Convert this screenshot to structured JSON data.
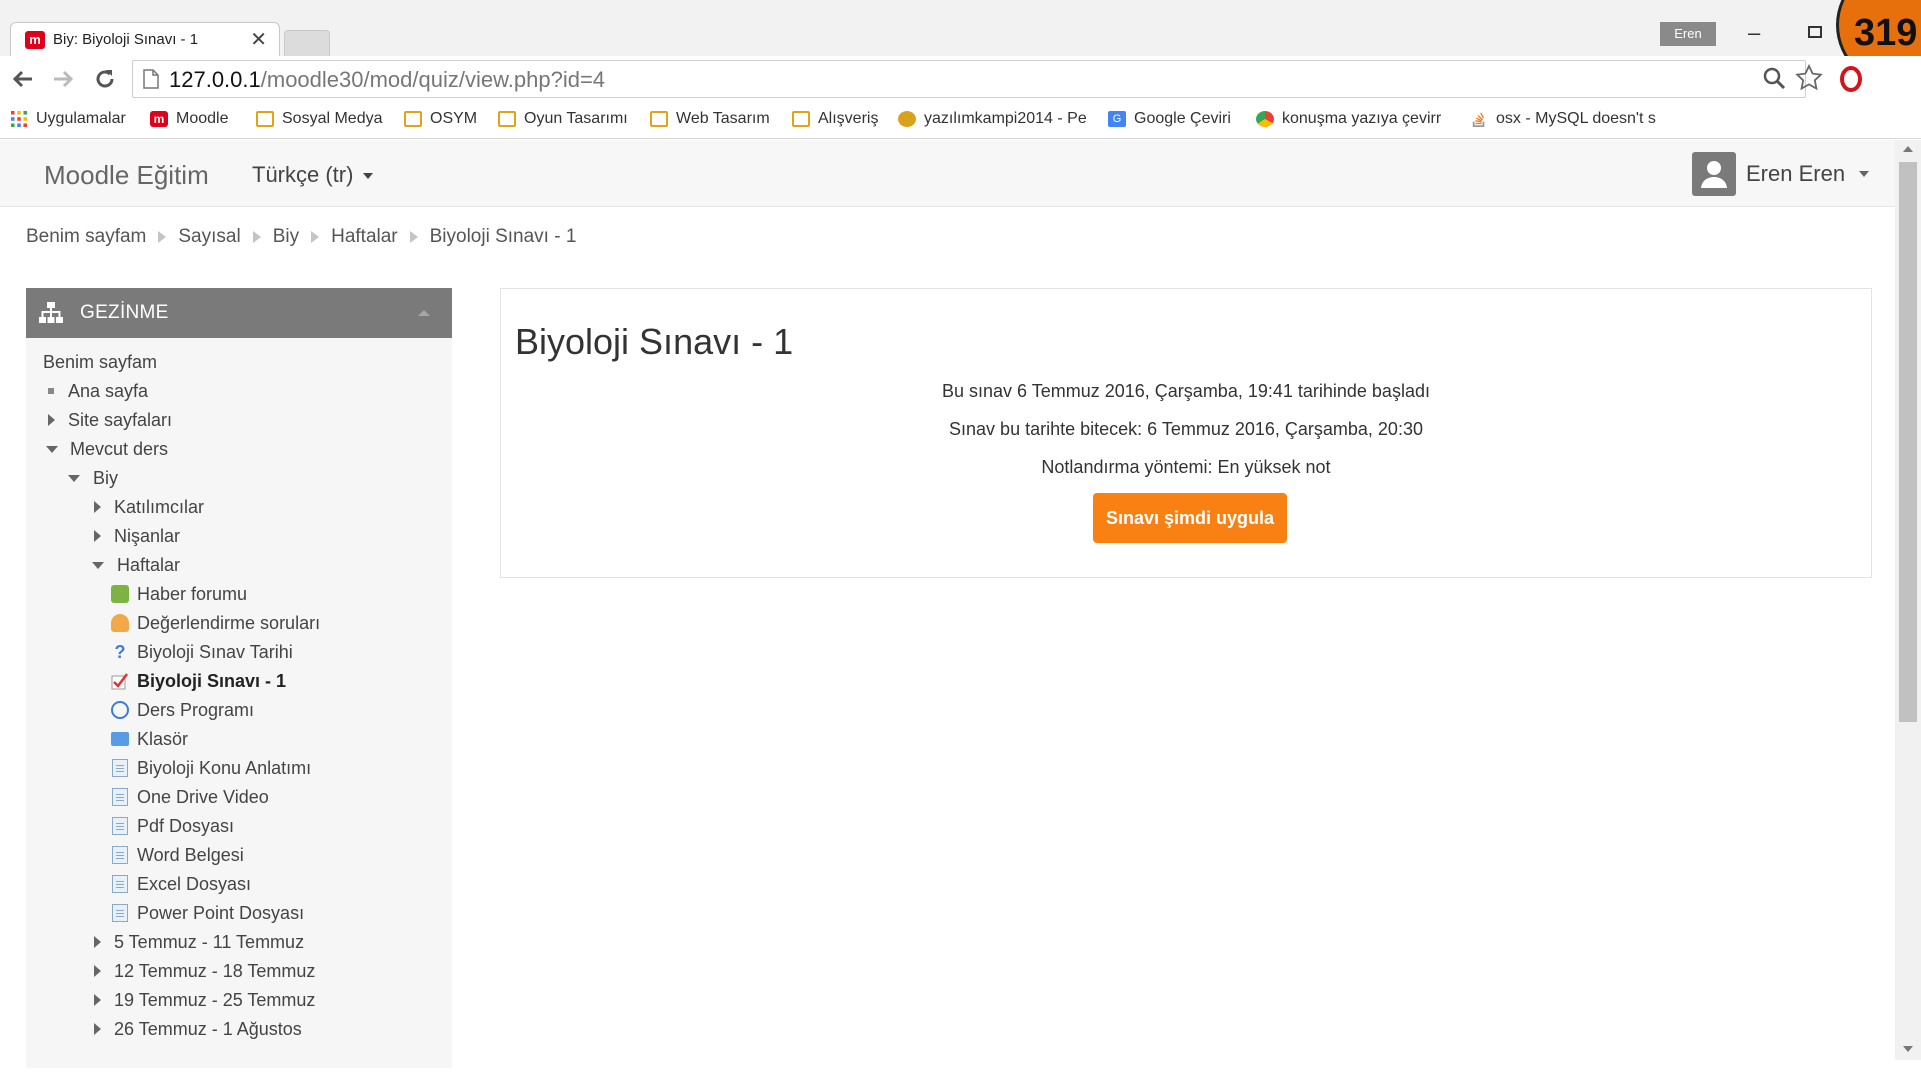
{
  "browser": {
    "tab_title": "Biy: Biyoloji Sınavı - 1",
    "tab_close": "✕",
    "user_chip": "Eren",
    "badge_number": "319",
    "url_host": "127.0.0.1",
    "url_path": "/moodle30/mod/quiz/view.php?id=4",
    "bookmarks": [
      "Uygulamalar",
      "Moodle",
      "Sosyal Medya",
      "OSYM",
      "Oyun Tasarımı",
      "Web Tasarım",
      "Alışveriş",
      "yazılımkampi2014 - Pe",
      "Google Çeviri",
      "konuşma yazıya çevirr",
      "osx - MySQL doesn't s"
    ]
  },
  "navbar": {
    "brand": "Moodle Eğitim",
    "language": "Türkçe (tr)",
    "user_name": "Eren Eren"
  },
  "breadcrumb": [
    "Benim sayfam",
    "Sayısal",
    "Biy",
    "Haftalar",
    "Biyoloji Sınavı - 1"
  ],
  "navigation": {
    "title": "GEZİNME",
    "items": [
      "Benim sayfam",
      "Ana sayfa",
      "Site sayfaları",
      "Mevcut ders",
      "Biy",
      "Katılımcılar",
      "Nişanlar",
      "Haftalar",
      "Haber forumu",
      "Değerlendirme soruları",
      "Biyoloji Sınav Tarihi",
      "Biyoloji Sınavı - 1",
      "Ders Programı",
      "Klasör",
      "Biyoloji Konu Anlatımı",
      "One Drive Video",
      "Pdf Dosyası",
      "Word Belgesi",
      "Excel Dosyası",
      "Power Point Dosyası",
      "5 Temmuz - 11 Temmuz",
      "12 Temmuz - 18 Temmuz",
      "19 Temmuz - 25 Temmuz",
      "26 Temmuz - 1 Ağustos"
    ]
  },
  "main": {
    "title": "Biyoloji Sınavı - 1",
    "opened": "Bu sınav 6 Temmuz 2016, Çarşamba, 19:41 tarihinde başladı",
    "closes": "Sınav bu tarihte bitecek: 6 Temmuz 2016, Çarşamba, 20:30",
    "grading": "Notlandırma yöntemi: En yüksek not",
    "button": "Sınavı şimdi uygula"
  },
  "colors": {
    "accent_button": "#f98012",
    "nav_header": "#7a7a7a",
    "badge": "#e8700c",
    "moodle_favicon": "#e0001b"
  }
}
